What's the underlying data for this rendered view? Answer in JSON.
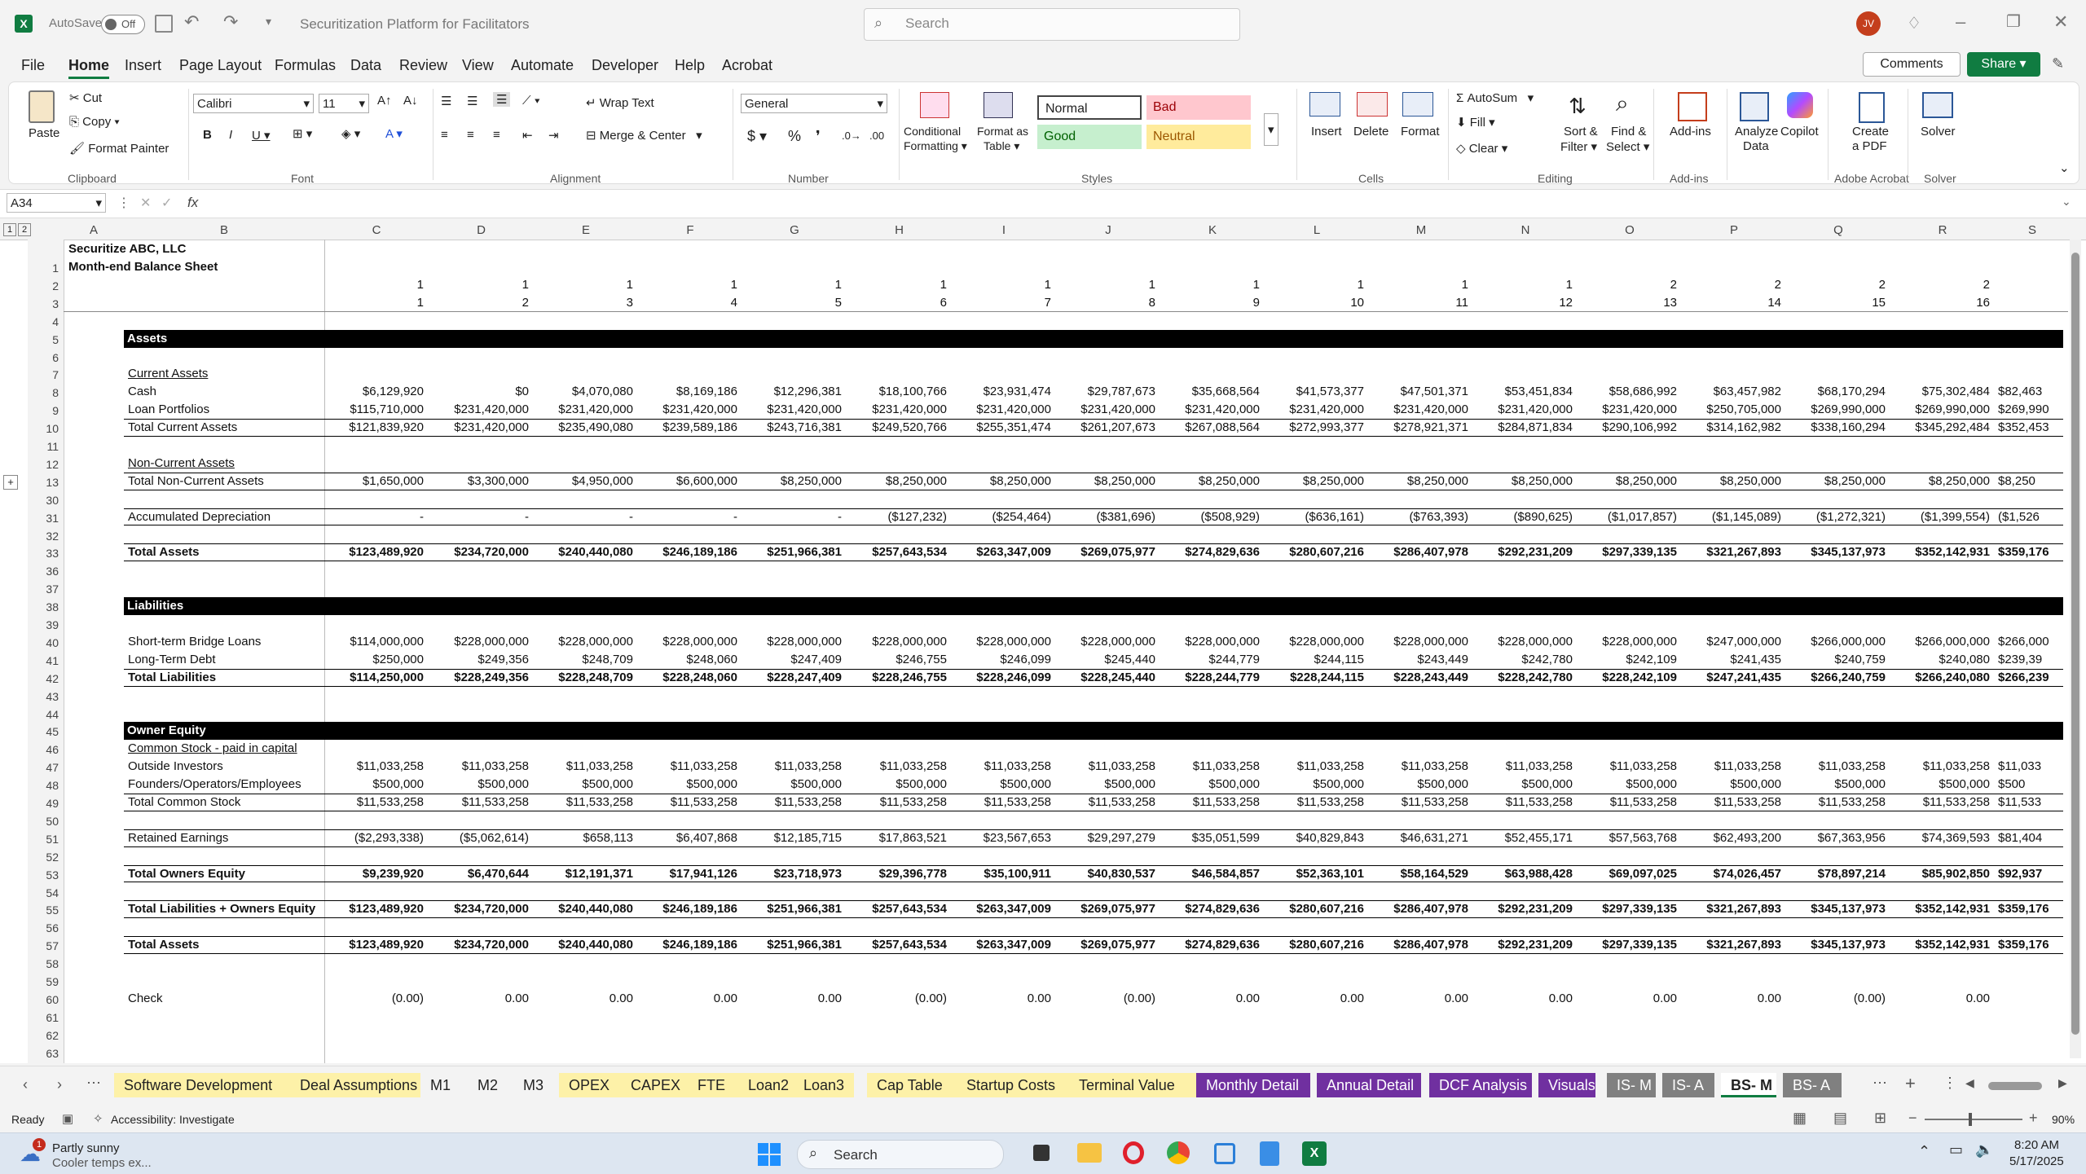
{
  "app": {
    "autosave_label": "AutoSave",
    "autosave_state": "Off",
    "title": "Securitization Platform for Facilitators",
    "search_placeholder": "Search",
    "user_initials": "JV"
  },
  "menu": [
    "File",
    "Home",
    "Insert",
    "Page Layout",
    "Formulas",
    "Data",
    "Review",
    "View",
    "Automate",
    "Developer",
    "Help",
    "Acrobat"
  ],
  "menu_right": {
    "comments": "Comments",
    "share": "Share"
  },
  "ribbon": {
    "clipboard": {
      "paste": "Paste",
      "cut": "Cut",
      "copy": "Copy",
      "format_painter": "Format Painter",
      "group": "Clipboard"
    },
    "font": {
      "name": "Calibri",
      "size": "11",
      "group": "Font"
    },
    "alignment": {
      "wrap": "Wrap Text",
      "merge": "Merge & Center",
      "group": "Alignment"
    },
    "number": {
      "format": "General",
      "group": "Number"
    },
    "styles": {
      "cond_1": "Conditional",
      "cond_2": "Formatting",
      "fat_1": "Format as",
      "fat_2": "Table",
      "normal": "Normal",
      "bad": "Bad",
      "good": "Good",
      "neutral": "Neutral",
      "group": "Styles"
    },
    "cells": {
      "insert": "Insert",
      "delete": "Delete",
      "format": "Format",
      "group": "Cells"
    },
    "editing": {
      "autosum": "AutoSum",
      "fill": "Fill",
      "clear": "Clear",
      "sort_1": "Sort &",
      "sort_2": "Filter",
      "find_1": "Find &",
      "find_2": "Select",
      "group": "Editing"
    },
    "addins": {
      "label": "Add-ins",
      "group": "Add-ins"
    },
    "analyze": {
      "l1": "Analyze",
      "l2": "Data"
    },
    "copilot": "Copilot",
    "acrobat": {
      "l1": "Create",
      "l2": "a PDF",
      "group": "Adobe Acrobat"
    },
    "solver": {
      "label": "Solver",
      "group": "Solver"
    }
  },
  "formula_bar": {
    "name_box": "A34",
    "fx": "fx",
    "content": ""
  },
  "columns": [
    "A",
    "B",
    "C",
    "D",
    "E",
    "F",
    "G",
    "H",
    "I",
    "J",
    "K",
    "L",
    "M",
    "N",
    "O",
    "P",
    "Q",
    "R",
    "S"
  ],
  "sheet": {
    "company": "Securitize ABC, LLC",
    "subtitle": "Month-end Balance Sheet",
    "row3": [
      "1",
      "1",
      "1",
      "1",
      "1",
      "1",
      "1",
      "1",
      "1",
      "1",
      "1",
      "1",
      "2",
      "2",
      "2",
      "2"
    ],
    "row4": [
      "1",
      "2",
      "3",
      "4",
      "5",
      "6",
      "7",
      "8",
      "9",
      "10",
      "11",
      "12",
      "13",
      "14",
      "15",
      "16"
    ],
    "rows": [
      {
        "n": "1"
      },
      {
        "n": "2"
      },
      {
        "n": "3"
      },
      {
        "n": "4"
      },
      {
        "n": "5"
      },
      {
        "n": "6",
        "band": "Assets"
      },
      {
        "n": "7"
      },
      {
        "n": "8",
        "label": "Current Assets",
        "underline": true
      },
      {
        "n": "9",
        "label": "Cash",
        "values": [
          "$6,129,920",
          "$0",
          "$4,070,080",
          "$8,169,186",
          "$12,296,381",
          "$18,100,766",
          "$23,931,474",
          "$29,787,673",
          "$35,668,564",
          "$41,573,377",
          "$47,501,371",
          "$53,451,834",
          "$58,686,992",
          "$63,457,982",
          "$68,170,294",
          "$75,302,484",
          "$82,463"
        ]
      },
      {
        "n": "10",
        "label": "Loan Portfolios",
        "values": [
          "$115,710,000",
          "$231,420,000",
          "$231,420,000",
          "$231,420,000",
          "$231,420,000",
          "$231,420,000",
          "$231,420,000",
          "$231,420,000",
          "$231,420,000",
          "$231,420,000",
          "$231,420,000",
          "$231,420,000",
          "$231,420,000",
          "$250,705,000",
          "$269,990,000",
          "$269,990,000",
          "$269,990"
        ]
      },
      {
        "n": "11",
        "label": "Total Current Assets",
        "line": true,
        "values": [
          "$121,839,920",
          "$231,420,000",
          "$235,490,080",
          "$239,589,186",
          "$243,716,381",
          "$249,520,766",
          "$255,351,474",
          "$261,207,673",
          "$267,088,564",
          "$272,993,377",
          "$278,921,371",
          "$284,871,834",
          "$290,106,992",
          "$314,162,982",
          "$338,160,294",
          "$345,292,484",
          "$352,453"
        ]
      },
      {
        "n": "12"
      },
      {
        "n": "13",
        "label": "Non-Current Assets",
        "underline": true
      },
      {
        "n": "30",
        "label": "Total Non-Current Assets",
        "line": true,
        "values": [
          "$1,650,000",
          "$3,300,000",
          "$4,950,000",
          "$6,600,000",
          "$8,250,000",
          "$8,250,000",
          "$8,250,000",
          "$8,250,000",
          "$8,250,000",
          "$8,250,000",
          "$8,250,000",
          "$8,250,000",
          "$8,250,000",
          "$8,250,000",
          "$8,250,000",
          "$8,250,000",
          "$8,250"
        ]
      },
      {
        "n": "31"
      },
      {
        "n": "32",
        "label": "Accumulated Depreciation",
        "line": true,
        "values": [
          "-",
          "-",
          "-",
          "-",
          "-",
          "($127,232)",
          "($254,464)",
          "($381,696)",
          "($508,929)",
          "($636,161)",
          "($763,393)",
          "($890,625)",
          "($1,017,857)",
          "($1,145,089)",
          "($1,272,321)",
          "($1,399,554)",
          "($1,526"
        ]
      },
      {
        "n": "33"
      },
      {
        "n": "36",
        "label": "Total Assets",
        "bold": true,
        "line": true,
        "values": [
          "$123,489,920",
          "$234,720,000",
          "$240,440,080",
          "$246,189,186",
          "$251,966,381",
          "$257,643,534",
          "$263,347,009",
          "$269,075,977",
          "$274,829,636",
          "$280,607,216",
          "$286,407,978",
          "$292,231,209",
          "$297,339,135",
          "$321,267,893",
          "$345,137,973",
          "$352,142,931",
          "$359,176"
        ]
      },
      {
        "n": "37"
      },
      {
        "n": "38"
      },
      {
        "n": "39",
        "band": "Liabilities"
      },
      {
        "n": "40"
      },
      {
        "n": "41",
        "label": "Short-term Bridge Loans",
        "values": [
          "$114,000,000",
          "$228,000,000",
          "$228,000,000",
          "$228,000,000",
          "$228,000,000",
          "$228,000,000",
          "$228,000,000",
          "$228,000,000",
          "$228,000,000",
          "$228,000,000",
          "$228,000,000",
          "$228,000,000",
          "$228,000,000",
          "$247,000,000",
          "$266,000,000",
          "$266,000,000",
          "$266,000"
        ]
      },
      {
        "n": "42",
        "label": "Long-Term Debt",
        "values": [
          "$250,000",
          "$249,356",
          "$248,709",
          "$248,060",
          "$247,409",
          "$246,755",
          "$246,099",
          "$245,440",
          "$244,779",
          "$244,115",
          "$243,449",
          "$242,780",
          "$242,109",
          "$241,435",
          "$240,759",
          "$240,080",
          "$239,39"
        ]
      },
      {
        "n": "43",
        "label": "Total Liabilities",
        "bold": true,
        "line": true,
        "values": [
          "$114,250,000",
          "$228,249,356",
          "$228,248,709",
          "$228,248,060",
          "$228,247,409",
          "$228,246,755",
          "$228,246,099",
          "$228,245,440",
          "$228,244,779",
          "$228,244,115",
          "$228,243,449",
          "$228,242,780",
          "$228,242,109",
          "$247,241,435",
          "$266,240,759",
          "$266,240,080",
          "$266,239"
        ]
      },
      {
        "n": "44"
      },
      {
        "n": "45"
      },
      {
        "n": "46",
        "band": "Owner Equity"
      },
      {
        "n": "47",
        "label": "Common Stock - paid in capital",
        "underline": true
      },
      {
        "n": "48",
        "label": "Outside Investors",
        "values": [
          "$11,033,258",
          "$11,033,258",
          "$11,033,258",
          "$11,033,258",
          "$11,033,258",
          "$11,033,258",
          "$11,033,258",
          "$11,033,258",
          "$11,033,258",
          "$11,033,258",
          "$11,033,258",
          "$11,033,258",
          "$11,033,258",
          "$11,033,258",
          "$11,033,258",
          "$11,033,258",
          "$11,033"
        ]
      },
      {
        "n": "49",
        "label": "Founders/Operators/Employees",
        "values": [
          "$500,000",
          "$500,000",
          "$500,000",
          "$500,000",
          "$500,000",
          "$500,000",
          "$500,000",
          "$500,000",
          "$500,000",
          "$500,000",
          "$500,000",
          "$500,000",
          "$500,000",
          "$500,000",
          "$500,000",
          "$500,000",
          "$500"
        ]
      },
      {
        "n": "50",
        "label": "Total Common Stock",
        "line": true,
        "values": [
          "$11,533,258",
          "$11,533,258",
          "$11,533,258",
          "$11,533,258",
          "$11,533,258",
          "$11,533,258",
          "$11,533,258",
          "$11,533,258",
          "$11,533,258",
          "$11,533,258",
          "$11,533,258",
          "$11,533,258",
          "$11,533,258",
          "$11,533,258",
          "$11,533,258",
          "$11,533,258",
          "$11,533"
        ]
      },
      {
        "n": "51"
      },
      {
        "n": "52",
        "label": "Retained Earnings",
        "line": true,
        "values": [
          "($2,293,338)",
          "($5,062,614)",
          "$658,113",
          "$6,407,868",
          "$12,185,715",
          "$17,863,521",
          "$23,567,653",
          "$29,297,279",
          "$35,051,599",
          "$40,829,843",
          "$46,631,271",
          "$52,455,171",
          "$57,563,768",
          "$62,493,200",
          "$67,363,956",
          "$74,369,593",
          "$81,404"
        ]
      },
      {
        "n": "53"
      },
      {
        "n": "54",
        "label": "Total Owners Equity",
        "bold": true,
        "line": true,
        "values": [
          "$9,239,920",
          "$6,470,644",
          "$12,191,371",
          "$17,941,126",
          "$23,718,973",
          "$29,396,778",
          "$35,100,911",
          "$40,830,537",
          "$46,584,857",
          "$52,363,101",
          "$58,164,529",
          "$63,988,428",
          "$69,097,025",
          "$74,026,457",
          "$78,897,214",
          "$85,902,850",
          "$92,937"
        ]
      },
      {
        "n": "55"
      },
      {
        "n": "56",
        "label": "Total Liabilities + Owners Equity",
        "bold": true,
        "line": true,
        "values": [
          "$123,489,920",
          "$234,720,000",
          "$240,440,080",
          "$246,189,186",
          "$251,966,381",
          "$257,643,534",
          "$263,347,009",
          "$269,075,977",
          "$274,829,636",
          "$280,607,216",
          "$286,407,978",
          "$292,231,209",
          "$297,339,135",
          "$321,267,893",
          "$345,137,973",
          "$352,142,931",
          "$359,176"
        ]
      },
      {
        "n": "57"
      },
      {
        "n": "58",
        "label": "Total Assets",
        "bold": true,
        "line": true,
        "values": [
          "$123,489,920",
          "$234,720,000",
          "$240,440,080",
          "$246,189,186",
          "$251,966,381",
          "$257,643,534",
          "$263,347,009",
          "$269,075,977",
          "$274,829,636",
          "$280,607,216",
          "$286,407,978",
          "$292,231,209",
          "$297,339,135",
          "$321,267,893",
          "$345,137,973",
          "$352,142,931",
          "$359,176"
        ]
      },
      {
        "n": "59"
      },
      {
        "n": "60"
      },
      {
        "n": "61",
        "label": "Check",
        "values": [
          "(0.00)",
          "0.00",
          "0.00",
          "0.00",
          "0.00",
          "(0.00)",
          "0.00",
          "(0.00)",
          "0.00",
          "0.00",
          "0.00",
          "0.00",
          "0.00",
          "0.00",
          "(0.00)",
          "0.00",
          ""
        ]
      },
      {
        "n": "62"
      },
      {
        "n": "63"
      },
      {
        "n": "64"
      }
    ]
  },
  "sheet_tabs": [
    {
      "label": "Software Development",
      "color": "#fdf1a8",
      "fg": "#222"
    },
    {
      "label": "Deal Assumptions",
      "color": "#fdf1a8",
      "fg": "#222"
    },
    {
      "label": "M1",
      "color": "#f3f3f3",
      "fg": "#222"
    },
    {
      "label": "M2",
      "color": "#f3f3f3",
      "fg": "#222"
    },
    {
      "label": "M3",
      "color": "#f3f3f3",
      "fg": "#222"
    },
    {
      "label": "OPEX",
      "color": "#fdf1a8",
      "fg": "#222"
    },
    {
      "label": "CAPEX",
      "color": "#fdf1a8",
      "fg": "#222"
    },
    {
      "label": "FTE",
      "color": "#fdf1a8",
      "fg": "#222"
    },
    {
      "label": "Loan2",
      "color": "#fdf1a8",
      "fg": "#222"
    },
    {
      "label": "Loan3",
      "color": "#fdf1a8",
      "fg": "#222"
    },
    {
      "label": "Cap Table",
      "color": "#fdf1a8",
      "fg": "#222"
    },
    {
      "label": "Startup Costs",
      "color": "#fdf1a8",
      "fg": "#222"
    },
    {
      "label": "Terminal Value",
      "color": "#fdf1a8",
      "fg": "#222"
    },
    {
      "label": "Monthly Detail",
      "color": "#7030a0",
      "fg": "#ffffff"
    },
    {
      "label": "Annual Detail",
      "color": "#7030a0",
      "fg": "#ffffff"
    },
    {
      "label": "DCF Analysis",
      "color": "#7030a0",
      "fg": "#ffffff"
    },
    {
      "label": "Visuals",
      "color": "#7030a0",
      "fg": "#ffffff"
    },
    {
      "label": "IS- M",
      "color": "#808080",
      "fg": "#ffffff"
    },
    {
      "label": "IS- A",
      "color": "#808080",
      "fg": "#ffffff"
    },
    {
      "label": "BS- M",
      "color": "#ffffff",
      "fg": "#222"
    },
    {
      "label": "BS- A",
      "color": "#808080",
      "fg": "#ffffff"
    }
  ],
  "status": {
    "ready": "Ready",
    "accessibility": "Accessibility: Investigate",
    "zoom": "90%"
  },
  "taskbar": {
    "weather_1": "Partly sunny",
    "weather_2": "Cooler temps ex...",
    "badge": "1",
    "search": "Search",
    "time": "8:20 AM",
    "date": "5/17/2025"
  }
}
